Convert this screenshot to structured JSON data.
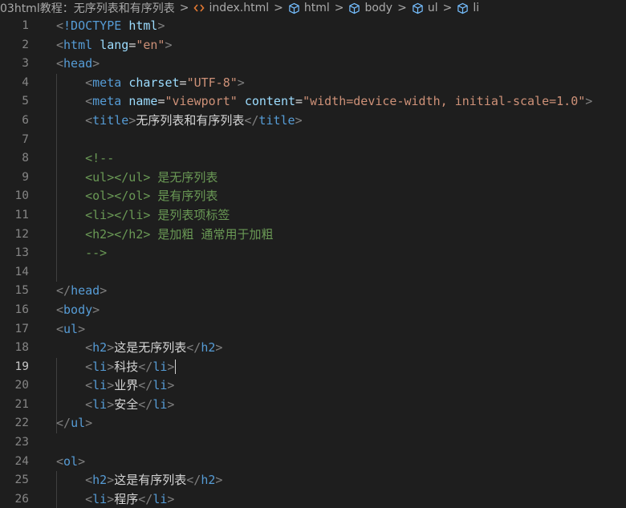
{
  "colors": {
    "background": "#1e1e1e",
    "punct": "#808080",
    "tag": "#569cd6",
    "attr": "#9cdcfe",
    "string": "#ce9178",
    "text": "#d4d4d4",
    "comment": "#6a9955",
    "line_number": "#858585",
    "line_number_active": "#c6c6c6",
    "breadcrumb": "#a9a9a9"
  },
  "breadcrumb": {
    "folder": "03html教程：无序列表和有序列表",
    "file": "index.html",
    "file_icon": "code-brackets-icon",
    "symbols": [
      {
        "label": "html",
        "icon": "cube-icon"
      },
      {
        "label": "body",
        "icon": "cube-icon"
      },
      {
        "label": "ul",
        "icon": "cube-icon"
      },
      {
        "label": "li",
        "icon": "cube-icon"
      }
    ],
    "separator": ">"
  },
  "editor": {
    "active_line": 19,
    "lines": [
      {
        "n": "1",
        "tokens": [
          [
            "punct",
            "<"
          ],
          [
            "doctype",
            "!DOCTYPE"
          ],
          [
            "text",
            " "
          ],
          [
            "attr",
            "html"
          ],
          [
            "punct",
            ">"
          ]
        ]
      },
      {
        "n": "2",
        "tokens": [
          [
            "punct",
            "<"
          ],
          [
            "tag",
            "html"
          ],
          [
            "text",
            " "
          ],
          [
            "attr",
            "lang"
          ],
          [
            "text",
            "="
          ],
          [
            "str",
            "\"en\""
          ],
          [
            "punct",
            ">"
          ]
        ]
      },
      {
        "n": "3",
        "tokens": [
          [
            "punct",
            "<"
          ],
          [
            "tag",
            "head"
          ],
          [
            "punct",
            ">"
          ]
        ]
      },
      {
        "n": "4",
        "tokens": [
          [
            "text",
            "    "
          ],
          [
            "punct",
            "<"
          ],
          [
            "tag",
            "meta"
          ],
          [
            "text",
            " "
          ],
          [
            "attr",
            "charset"
          ],
          [
            "text",
            "="
          ],
          [
            "str",
            "\"UTF-8\""
          ],
          [
            "punct",
            ">"
          ]
        ]
      },
      {
        "n": "5",
        "tokens": [
          [
            "text",
            "    "
          ],
          [
            "punct",
            "<"
          ],
          [
            "tag",
            "meta"
          ],
          [
            "text",
            " "
          ],
          [
            "attr",
            "name"
          ],
          [
            "text",
            "="
          ],
          [
            "str",
            "\"viewport\""
          ],
          [
            "text",
            " "
          ],
          [
            "attr",
            "content"
          ],
          [
            "text",
            "="
          ],
          [
            "str",
            "\"width=device-width, initial-scale=1.0\""
          ],
          [
            "punct",
            ">"
          ]
        ]
      },
      {
        "n": "6",
        "tokens": [
          [
            "text",
            "    "
          ],
          [
            "punct",
            "<"
          ],
          [
            "tag",
            "title"
          ],
          [
            "punct",
            ">"
          ],
          [
            "text",
            "无序列表和有序列表"
          ],
          [
            "punct",
            "</"
          ],
          [
            "tag",
            "title"
          ],
          [
            "punct",
            ">"
          ]
        ]
      },
      {
        "n": "7",
        "tokens": []
      },
      {
        "n": "8",
        "tokens": [
          [
            "text",
            "    "
          ],
          [
            "comment",
            "<!--"
          ]
        ]
      },
      {
        "n": "9",
        "tokens": [
          [
            "text",
            "    "
          ],
          [
            "comment",
            "<ul></ul> 是无序列表"
          ]
        ]
      },
      {
        "n": "10",
        "tokens": [
          [
            "text",
            "    "
          ],
          [
            "comment",
            "<ol></ol> 是有序列表"
          ]
        ]
      },
      {
        "n": "11",
        "tokens": [
          [
            "text",
            "    "
          ],
          [
            "comment",
            "<li></li> 是列表项标签"
          ]
        ]
      },
      {
        "n": "12",
        "tokens": [
          [
            "text",
            "    "
          ],
          [
            "comment",
            "<h2></h2> 是加粗 通常用于加粗"
          ]
        ]
      },
      {
        "n": "13",
        "tokens": [
          [
            "text",
            "    "
          ],
          [
            "comment",
            "-->"
          ]
        ]
      },
      {
        "n": "14",
        "tokens": []
      },
      {
        "n": "15",
        "tokens": [
          [
            "punct",
            "</"
          ],
          [
            "tag",
            "head"
          ],
          [
            "punct",
            ">"
          ]
        ]
      },
      {
        "n": "16",
        "tokens": [
          [
            "punct",
            "<"
          ],
          [
            "tag",
            "body"
          ],
          [
            "punct",
            ">"
          ]
        ]
      },
      {
        "n": "17",
        "tokens": [
          [
            "punct",
            "<"
          ],
          [
            "tag",
            "ul"
          ],
          [
            "punct",
            ">"
          ]
        ]
      },
      {
        "n": "18",
        "tokens": [
          [
            "text",
            "    "
          ],
          [
            "punct",
            "<"
          ],
          [
            "tag",
            "h2"
          ],
          [
            "punct",
            ">"
          ],
          [
            "text",
            "这是无序列表"
          ],
          [
            "punct",
            "</"
          ],
          [
            "tag",
            "h2"
          ],
          [
            "punct",
            ">"
          ]
        ]
      },
      {
        "n": "19",
        "tokens": [
          [
            "text",
            "    "
          ],
          [
            "punct",
            "<"
          ],
          [
            "tag",
            "li"
          ],
          [
            "punct",
            ">"
          ],
          [
            "text",
            "科技"
          ],
          [
            "punct",
            "</"
          ],
          [
            "tag",
            "li"
          ],
          [
            "punct",
            ">"
          ]
        ]
      },
      {
        "n": "20",
        "tokens": [
          [
            "text",
            "    "
          ],
          [
            "punct",
            "<"
          ],
          [
            "tag",
            "li"
          ],
          [
            "punct",
            ">"
          ],
          [
            "text",
            "业界"
          ],
          [
            "punct",
            "</"
          ],
          [
            "tag",
            "li"
          ],
          [
            "punct",
            ">"
          ]
        ]
      },
      {
        "n": "21",
        "tokens": [
          [
            "text",
            "    "
          ],
          [
            "punct",
            "<"
          ],
          [
            "tag",
            "li"
          ],
          [
            "punct",
            ">"
          ],
          [
            "text",
            "安全"
          ],
          [
            "punct",
            "</"
          ],
          [
            "tag",
            "li"
          ],
          [
            "punct",
            ">"
          ]
        ]
      },
      {
        "n": "22",
        "tokens": [
          [
            "punct",
            "</"
          ],
          [
            "tag",
            "ul"
          ],
          [
            "punct",
            ">"
          ]
        ]
      },
      {
        "n": "23",
        "tokens": []
      },
      {
        "n": "24",
        "tokens": [
          [
            "punct",
            "<"
          ],
          [
            "tag",
            "ol"
          ],
          [
            "punct",
            ">"
          ]
        ]
      },
      {
        "n": "25",
        "tokens": [
          [
            "text",
            "    "
          ],
          [
            "punct",
            "<"
          ],
          [
            "tag",
            "h2"
          ],
          [
            "punct",
            ">"
          ],
          [
            "text",
            "这是有序列表"
          ],
          [
            "punct",
            "</"
          ],
          [
            "tag",
            "h2"
          ],
          [
            "punct",
            ">"
          ]
        ]
      },
      {
        "n": "26",
        "tokens": [
          [
            "text",
            "    "
          ],
          [
            "punct",
            "<"
          ],
          [
            "tag",
            "li"
          ],
          [
            "punct",
            ">"
          ],
          [
            "text",
            "程序"
          ],
          [
            "punct",
            "</"
          ],
          [
            "tag",
            "li"
          ],
          [
            "punct",
            ">"
          ]
        ]
      }
    ]
  }
}
